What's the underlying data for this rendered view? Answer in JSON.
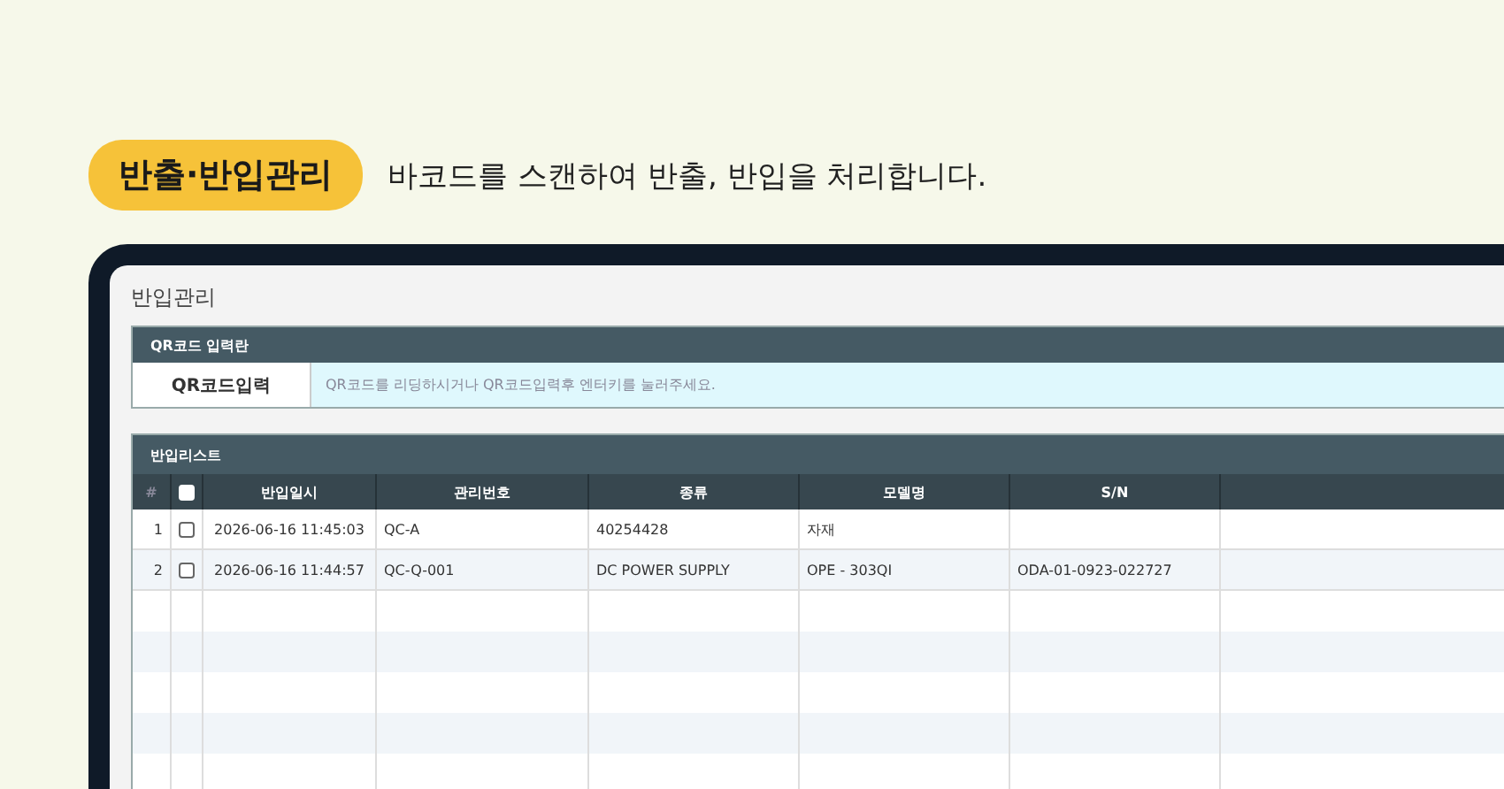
{
  "header": {
    "badge": "반출·반입관리",
    "description": "바코드를 스캔하여 반출, 반입을 처리합니다."
  },
  "page": {
    "title": "반입관리"
  },
  "qr_section": {
    "title": "QR코드 입력란",
    "label": "QR코드입력",
    "placeholder": "QR코드를 리딩하시거나 QR코드입력후 엔터키를 눌러주세요."
  },
  "list_section": {
    "title": "반입리스트",
    "index_header": "#",
    "select_all_checked": false,
    "columns": [
      "반입일시",
      "관리번호",
      "종류",
      "모델명",
      "S/N"
    ],
    "rows": [
      {
        "index": "1",
        "checked": false,
        "cells": [
          "2026-06-16 11:45:03",
          "QC-A",
          "40254428",
          "자재",
          ""
        ]
      },
      {
        "index": "2",
        "checked": false,
        "cells": [
          "2026-06-16 11:44:57",
          "QC-Q-001",
          "DC POWER SUPPLY",
          "OPE - 303QI",
          "ODA-01-0923-022727"
        ]
      }
    ]
  }
}
